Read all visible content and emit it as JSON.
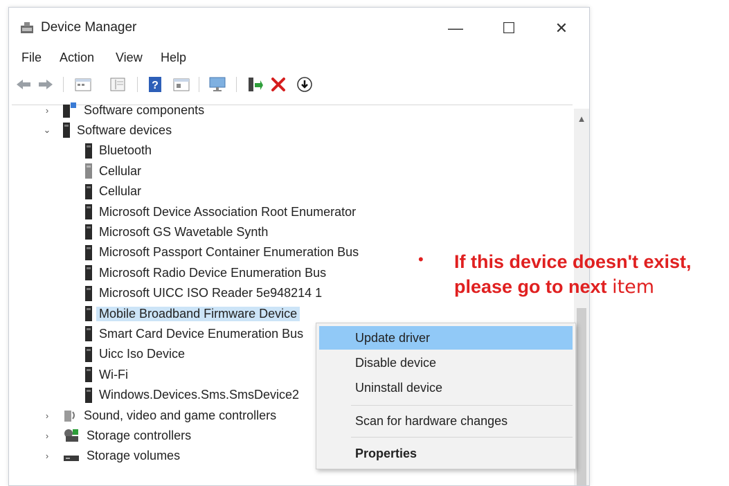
{
  "window": {
    "title": "Device Manager",
    "minimize_glyph": "—",
    "maximize_glyph": "☐",
    "close_glyph": "✕"
  },
  "menu": {
    "items": [
      "File",
      "Action",
      "View",
      "Help"
    ]
  },
  "toolbar": {
    "icons": [
      "back-arrow-icon",
      "forward-arrow-icon",
      "properties-icon",
      "view-icon",
      "help-icon",
      "panel-icon",
      "monitor-icon",
      "update-driver-icon",
      "uninstall-x-icon",
      "download-icon"
    ]
  },
  "tree": {
    "categories": {
      "software_components": "Software components",
      "software_devices": "Software devices",
      "sound": "Sound, video and game controllers",
      "storage_controllers": "Storage controllers",
      "storage_volumes": "Storage volumes"
    },
    "software_devices_children": [
      "Bluetooth",
      "Cellular",
      "Cellular",
      "Microsoft Device Association Root Enumerator",
      "Microsoft GS Wavetable Synth",
      "Microsoft Passport Container Enumeration Bus",
      "Microsoft Radio Device Enumeration Bus",
      "Microsoft UICC ISO Reader 5e948214 1",
      "Mobile Broadband Firmware Device",
      "Smart Card Device Enumeration Bus",
      "Uicc Iso Device",
      "Wi-Fi",
      "Windows.Devices.Sms.SmsDevice2"
    ],
    "expander_collapsed": "›",
    "expander_expanded": "⌄"
  },
  "context_menu": {
    "update_driver": "Update driver",
    "disable_device": "Disable device",
    "uninstall_device": "Uninstall device",
    "scan": "Scan for hardware changes",
    "properties": "Properties"
  },
  "annotation": {
    "bullet": "•",
    "line1": "If this device doesn't exist,",
    "line2_bold": "please go to next ",
    "line2_tail": "item"
  },
  "colors": {
    "selection": "#cce4f7",
    "menu_highlight": "#91c9f7",
    "annotation": "#e02020"
  }
}
